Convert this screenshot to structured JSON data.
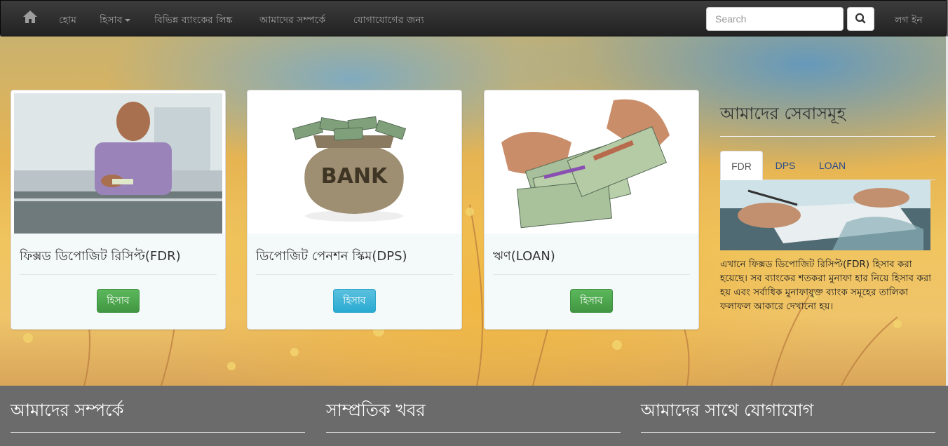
{
  "navbar": {
    "home_label": "হোম",
    "accounts_label": "হিসাব",
    "bank_links_label": "বিভিন্ন ব্যাংকের লিঙ্ক",
    "about_label": "আমাদের সম্পর্কে",
    "contact_label": "যোগাযোগের জন্য",
    "search_placeholder": "Search",
    "login_label": "লগ ইন"
  },
  "cards": [
    {
      "title": "ফিক্সড ডিপোজিট রিসিপ্ট(FDR)",
      "button_label": "হিসাব",
      "button_color": "#5cb85c"
    },
    {
      "title": "ডিপোজিট পেনশন স্কিম(DPS)",
      "button_label": "হিসাব",
      "button_color": "#5bc0de",
      "image_text": "BANK"
    },
    {
      "title": "ঋণ(LOAN)",
      "button_label": "হিসাব",
      "button_color": "#5cb85c"
    }
  ],
  "services": {
    "title": "আমাদের সেবাসমূহ",
    "tabs": [
      {
        "label": "FDR",
        "active": true
      },
      {
        "label": "DPS",
        "active": false
      },
      {
        "label": "LOAN",
        "active": false
      }
    ],
    "description": "এখানে ফিক্সড ডিপোজিট রিসিপ্ট(FDR) হিসাব করা হয়েছে। সব ব্যাংকের শতকরা মুনাফা হার নিয়ে হিসাব করা হয় এবং সর্বাধিক মুনাফাযুক্ত ব্যাংক সমূহের তালিকা ফলাফল আকারে দেখানো হয়।"
  },
  "footer": {
    "about_heading": "আমাদের সম্পর্কে",
    "news_heading": "সাম্প্রতিক খবর",
    "contact_heading": "আমাদের সাথে যোগাযোগ"
  },
  "colors": {
    "navbar_bg": "#222222",
    "footer_bg": "#6b6b6b",
    "btn_success": "#5cb85c",
    "btn_info": "#5bc0de"
  }
}
